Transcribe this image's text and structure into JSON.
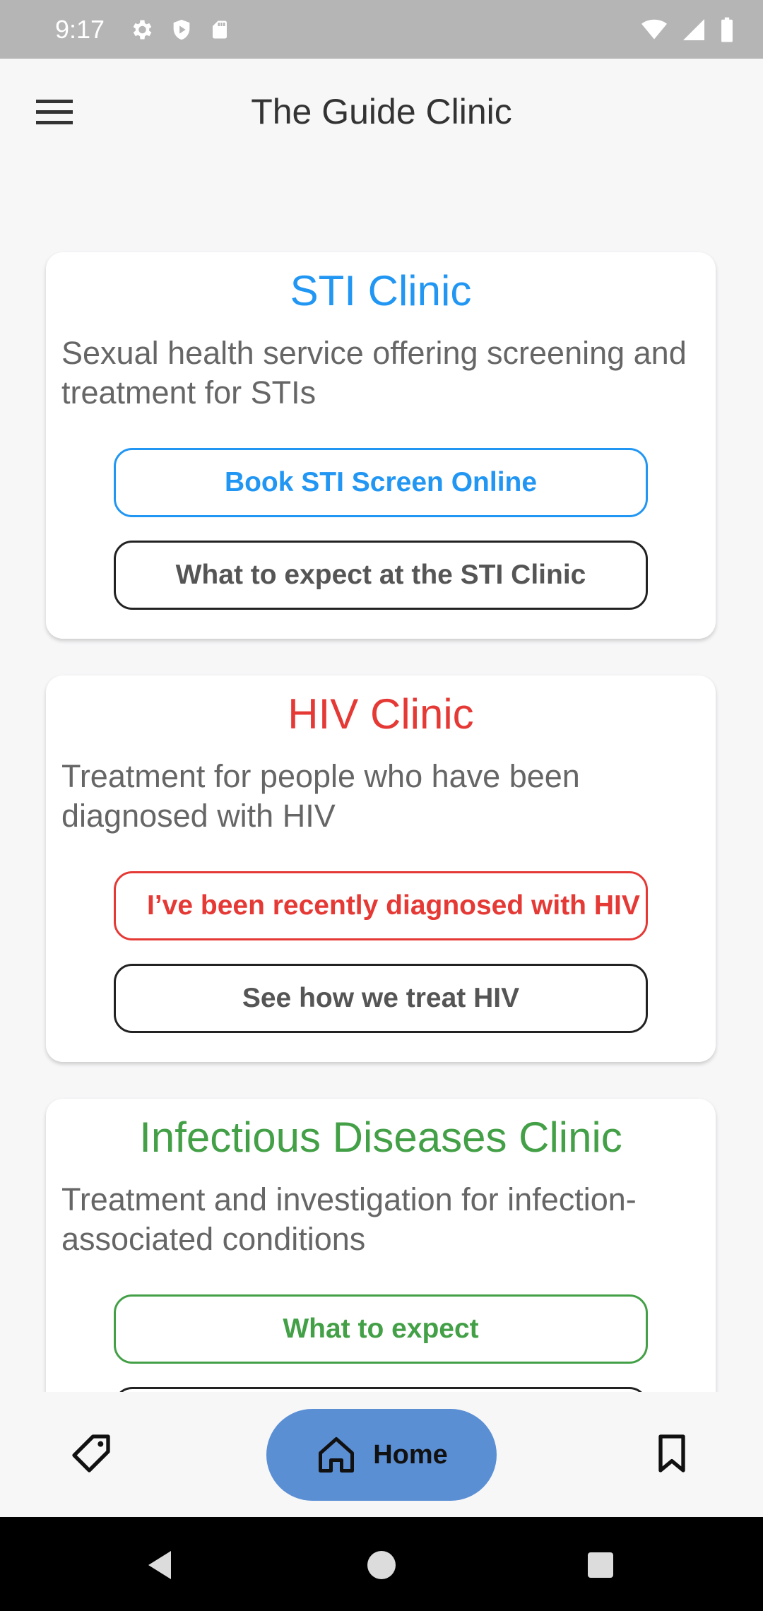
{
  "status_bar": {
    "time": "9:17"
  },
  "app_bar": {
    "title": "The Guide Clinic"
  },
  "cards": [
    {
      "title": "STI Clinic",
      "title_color": "#2196f3",
      "description": "Sexual health service offering screening and treatment for STIs",
      "primary_button": "Book STI Screen Online",
      "secondary_button": "What to expect at the STI Clinic"
    },
    {
      "title": "HIV Clinic",
      "title_color": "#e53935",
      "description": "Treatment for people who have been diagnosed with HIV",
      "primary_button": "I’ve been recently diagnosed with HIV",
      "secondary_button": "See how we treat HIV"
    },
    {
      "title": "Infectious Diseases Clinic",
      "title_color": "#43a047",
      "description": "Treatment and investigation for infection-associated conditions",
      "primary_button": "What to expect"
    }
  ],
  "bottom_nav": {
    "left_icon": "tag-icon",
    "home_label": "Home",
    "right_icon": "bookmark-icon",
    "active_color": "#5b8fd4"
  },
  "system_nav": {
    "back": "back-icon",
    "home": "home-circle-icon",
    "recents": "recents-icon"
  }
}
